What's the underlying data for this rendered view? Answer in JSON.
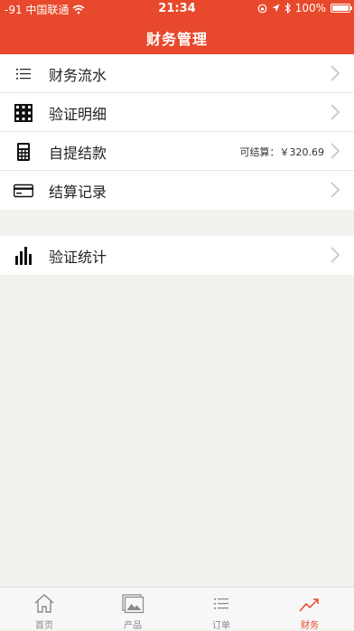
{
  "status": {
    "carrier": "-91 中国联通",
    "time": "21:34",
    "battery": "100%",
    "battery_level": 1.0
  },
  "header": {
    "title": "财务管理"
  },
  "group1": [
    {
      "label": "财务流水",
      "icon": "list-icon"
    },
    {
      "label": "验证明细",
      "icon": "grid-icon"
    },
    {
      "label": "自提结款",
      "icon": "calculator-icon",
      "value": "可结算：￥320.69"
    },
    {
      "label": "结算记录",
      "icon": "card-icon"
    }
  ],
  "group2": [
    {
      "label": "验证统计",
      "icon": "bar-chart-icon"
    }
  ],
  "tabs": [
    {
      "label": "首页",
      "icon": "home-icon"
    },
    {
      "label": "产品",
      "icon": "photos-icon"
    },
    {
      "label": "订单",
      "icon": "list-icon"
    },
    {
      "label": "财务",
      "icon": "trend-icon",
      "active": true
    }
  ],
  "colors": {
    "accent": "#e8482b",
    "background": "#f2f1ee",
    "inactive": "#888888"
  }
}
